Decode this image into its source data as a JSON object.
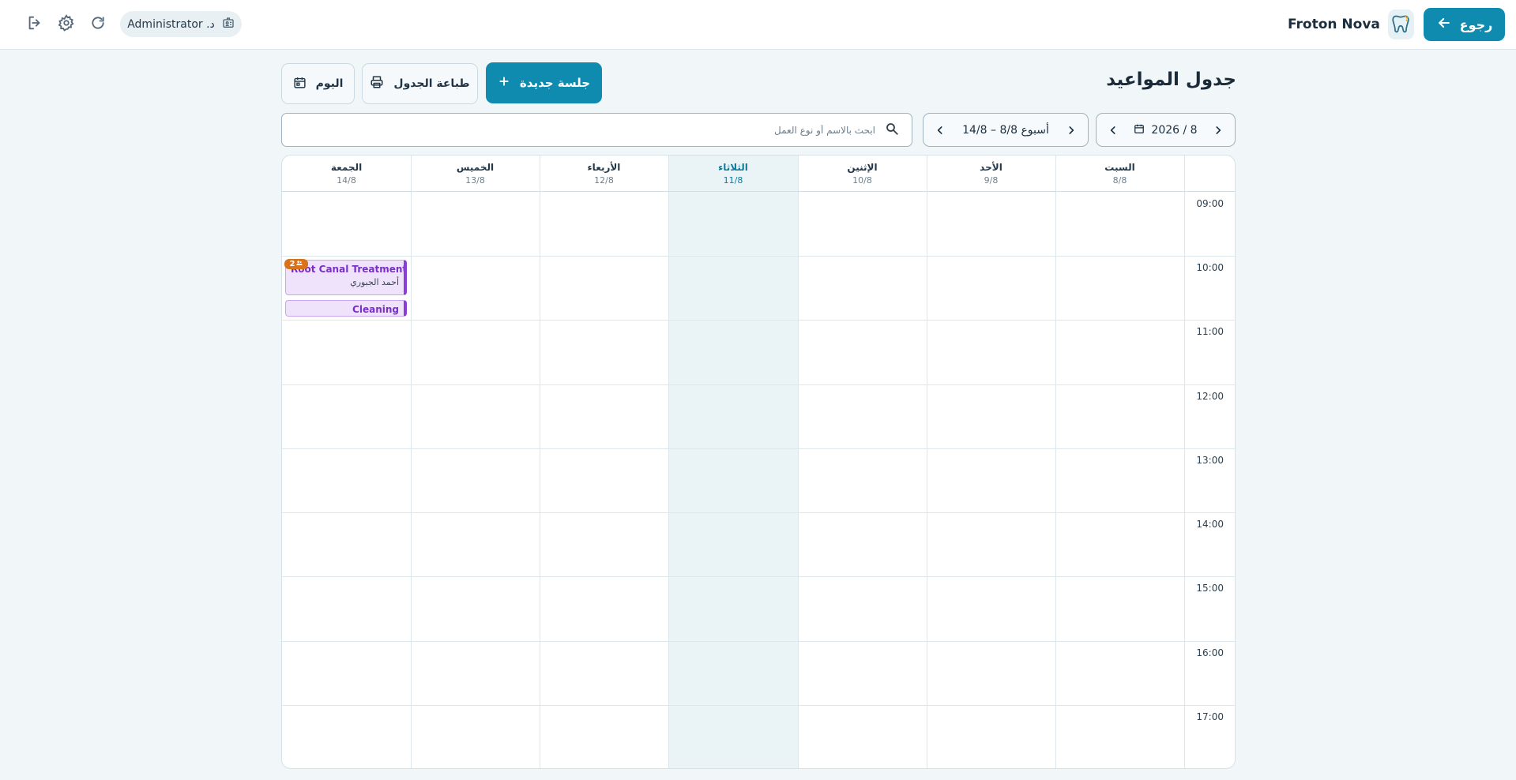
{
  "header": {
    "user_label": "د. Administrator",
    "brand_name": "Froton Nova",
    "back_label": "رجوع"
  },
  "page": {
    "title": "جدول المواعيد",
    "new_session_label": "جلسة جديدة",
    "print_label": "طباعة الجدول",
    "today_label": "اليوم"
  },
  "filters": {
    "search_placeholder": "ابحث بالاسم أو نوع العمل",
    "week_label": "أسبوع 8/8 – 14/8",
    "month_label": "8 / 2026"
  },
  "calendar": {
    "days": [
      {
        "name": "السبت",
        "date": "8/8"
      },
      {
        "name": "الأحد",
        "date": "9/8"
      },
      {
        "name": "الإثنين",
        "date": "10/8"
      },
      {
        "name": "الثلاثاء",
        "date": "11/8"
      },
      {
        "name": "الأربعاء",
        "date": "12/8"
      },
      {
        "name": "الخميس",
        "date": "13/8"
      },
      {
        "name": "الجمعة",
        "date": "14/8"
      }
    ],
    "today_index": 3,
    "hours": [
      "09:00",
      "10:00",
      "11:00",
      "12:00",
      "13:00",
      "14:00",
      "15:00",
      "16:00",
      "17:00"
    ],
    "overlap_badge": "2",
    "appointments": [
      {
        "title": "Root Canal Treatment",
        "patient": "أحمد الجبوري",
        "day": "14/8"
      },
      {
        "title": "Cleaning",
        "patient": "",
        "day": "14/8"
      }
    ]
  },
  "colors": {
    "primary": "#0f8bb0",
    "appointment": "#8b3ed6",
    "badge": "#d9731a",
    "today_column": "#eaf3f6"
  }
}
